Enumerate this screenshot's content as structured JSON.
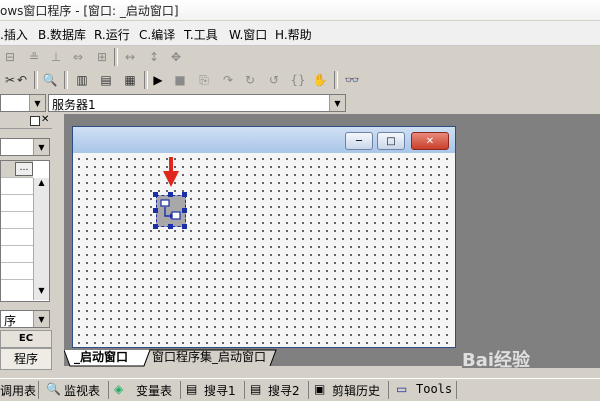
{
  "window": {
    "title": "ows窗口程序 - [窗口: _启动窗口]"
  },
  "menu": [
    {
      "label": ".插入"
    },
    {
      "label": "B.数据库"
    },
    {
      "label": "R.运行"
    },
    {
      "label": "C.编译"
    },
    {
      "label": "T.工具"
    },
    {
      "label": "W.窗口"
    },
    {
      "label": "H.帮助"
    }
  ],
  "toolbar_combo": {
    "server": "服务器1"
  },
  "left_panel": {
    "combo_bottom": "序",
    "ec_label": "EC",
    "tab_label": "程序"
  },
  "design_window": {
    "minimize": "─",
    "maximize": "□",
    "close": "✕"
  },
  "tabs": [
    {
      "label": "_启动窗口"
    },
    {
      "label": "窗口程序集_启动窗口"
    }
  ],
  "statusbar": [
    {
      "label": "调用表",
      "icon": ""
    },
    {
      "label": "监视表",
      "icon": "magnifier-icon"
    },
    {
      "label": "变量表",
      "icon": "variables-icon"
    },
    {
      "label": "搜寻1",
      "icon": "search-icon"
    },
    {
      "label": "搜寻2",
      "icon": "search-icon"
    },
    {
      "label": "剪辑历史",
      "icon": "clipboard-icon"
    },
    {
      "label": "Tools",
      "icon": "window-icon"
    }
  ],
  "watermark": "Bai经验",
  "colors": {
    "arrow": "#e1261c",
    "selection_handle": "#1a2fa8",
    "dialog_border": "#2b4e87"
  }
}
